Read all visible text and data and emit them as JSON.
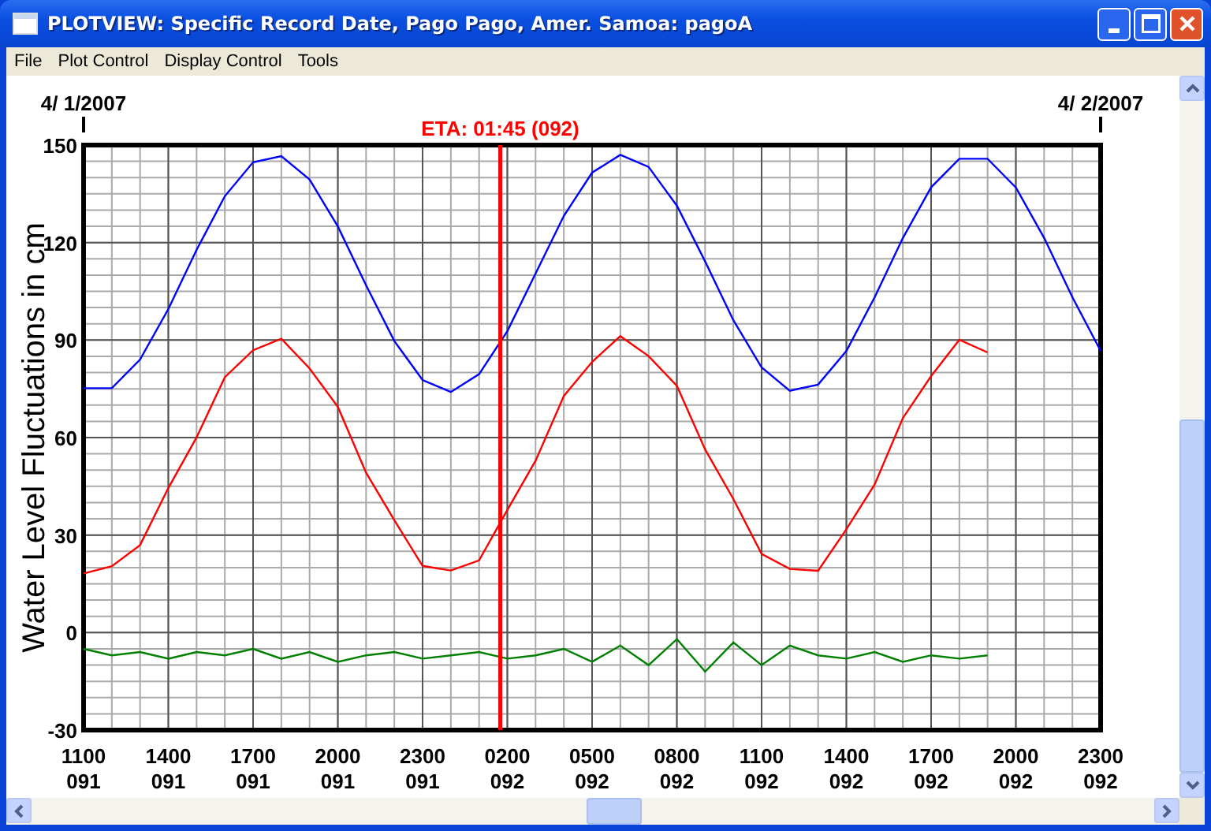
{
  "window": {
    "title": "PLOTVIEW: Specific Record Date, Pago Pago, Amer. Samoa: pagoA"
  },
  "menu": [
    {
      "label": "File"
    },
    {
      "label": "Plot Control"
    },
    {
      "label": "Display Control"
    },
    {
      "label": "Tools"
    }
  ],
  "chart": {
    "date_markers": [
      {
        "label": "4/ 1/2007"
      },
      {
        "label": "4/ 2/2007"
      }
    ],
    "chart_data": {
      "type": "line",
      "ylabel": "Water Level Fluctuations in cm",
      "categories": [
        "1100\n091",
        null,
        null,
        "1400\n091",
        null,
        null,
        "1700\n091",
        null,
        null,
        "2000\n091",
        null,
        null,
        "2300\n091",
        null,
        null,
        "0200\n092",
        null,
        null,
        "0500\n092",
        null,
        null,
        "0800\n092",
        null,
        null,
        "1100\n092",
        null,
        null,
        "1400\n092",
        null,
        null,
        "1700\n092",
        null,
        null,
        "2000\n092",
        null,
        null,
        "2300\n092"
      ],
      "series": [
        {
          "color": "#0000ff",
          "values": [
            75.2,
            75.2,
            84.0,
            99.6,
            117.8,
            134.3,
            144.7,
            146.6,
            139.4,
            124.9,
            106.8,
            89.7,
            77.7,
            74.0,
            79.5,
            92.8,
            110.5,
            128.2,
            141.5,
            147.0,
            143.3,
            131.3,
            114.2,
            96.1,
            81.6,
            74.4,
            76.3,
            86.7,
            103.2,
            121.4,
            137.0,
            145.8,
            145.8,
            136.9,
            121.4,
            103.2,
            86.7
          ]
        },
        {
          "color": "#ff0000",
          "values": [
            18.2,
            20.4,
            26.9,
            44.5,
            60.1,
            78.6,
            86.9,
            90.4,
            81.3,
            69.4,
            49.2,
            34.6,
            20.5,
            19.1,
            22.2,
            37.8,
            52.9,
            72.8,
            83.3,
            91.2,
            85.1,
            75.9,
            56.3,
            41.1,
            24.2,
            19.6,
            19.0,
            31.8,
            45.6,
            66.0,
            78.9,
            90.1,
            86.2,
            null,
            null,
            null,
            null
          ]
        },
        {
          "color": "#008000",
          "values": [
            -5,
            -7,
            -6,
            -8,
            -6,
            -7,
            -5,
            -8,
            -6,
            -9,
            -7,
            -6,
            -8,
            -7,
            -6,
            -8,
            -7,
            -5,
            -9,
            -4,
            -10,
            -2,
            -12,
            -3,
            -10,
            -4,
            -7,
            -8,
            -6,
            -9,
            -7,
            -8,
            -7,
            null,
            null,
            null,
            null
          ]
        }
      ],
      "ylim": [
        -30,
        150
      ],
      "yticks": [
        -30,
        0,
        30,
        60,
        90,
        120,
        150
      ],
      "grid": true,
      "annotations": [
        "ETA: 01:45 (092)"
      ]
    }
  }
}
